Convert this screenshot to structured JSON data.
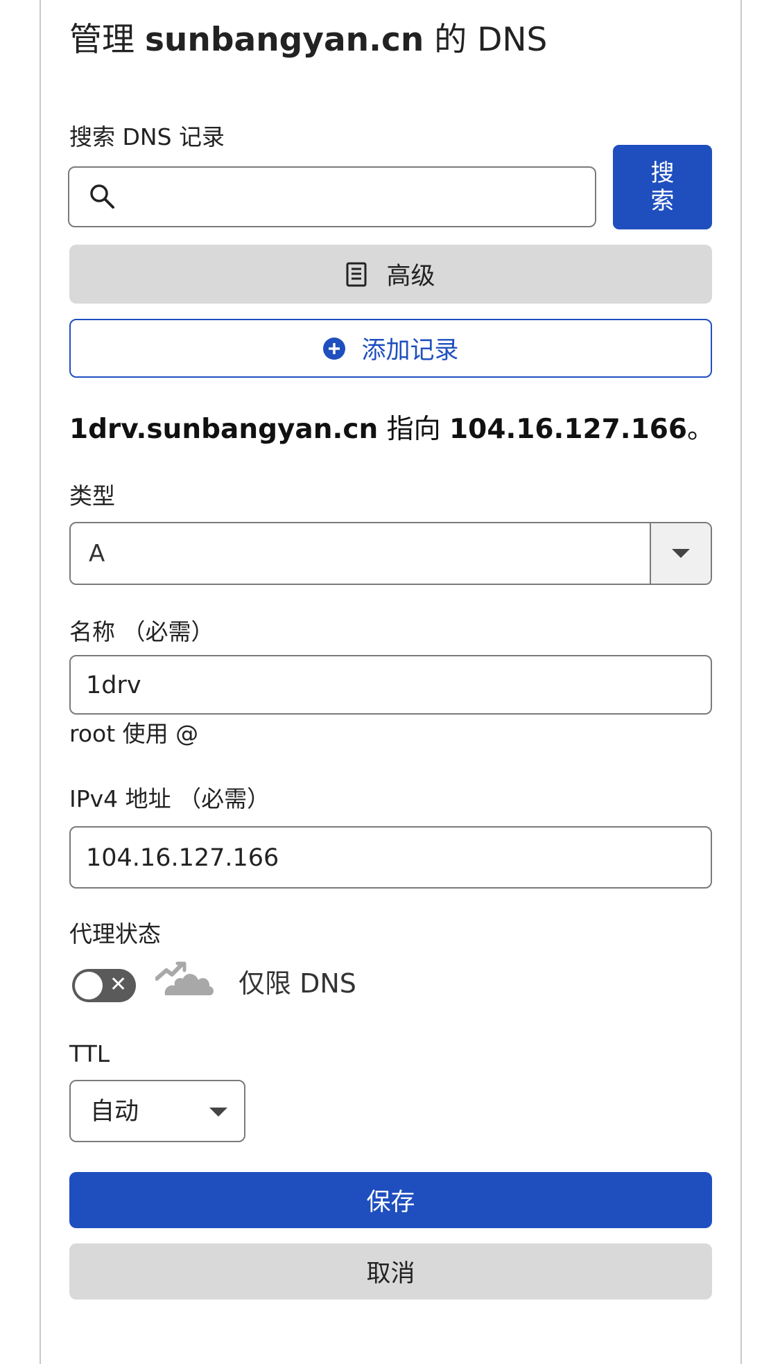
{
  "header": {
    "title_prefix": "管理",
    "domain": "sunbangyan.cn",
    "title_suffix": "的 DNS"
  },
  "search": {
    "label": "搜索 DNS 记录",
    "value": "",
    "placeholder": "",
    "button_line1": "搜",
    "button_line2": "索"
  },
  "actions": {
    "advanced_label": "高级",
    "add_record_label": "添加记录"
  },
  "summary": {
    "hostname": "1drv.sunbangyan.cn",
    "points_to": "指向",
    "ip": "104.16.127.166",
    "period": "。"
  },
  "form": {
    "type": {
      "label": "类型",
      "value": "A"
    },
    "name": {
      "label": "名称 （必需）",
      "value": "1drv",
      "hint": "root 使用 @"
    },
    "ipv4": {
      "label": "IPv4 地址 （必需）",
      "value": "104.16.127.166"
    },
    "proxy": {
      "label": "代理状态",
      "enabled": false,
      "toggle_glyph": "✕",
      "status_text": "仅限 DNS",
      "icon": "cloud-dns-only-icon"
    },
    "ttl": {
      "label": "TTL",
      "value": "自动"
    }
  },
  "buttons": {
    "save": "保存",
    "cancel": "取消"
  },
  "colors": {
    "primary": "#1f4fbf",
    "gray_button": "#d9d9d9",
    "border": "#7a7a7a"
  }
}
